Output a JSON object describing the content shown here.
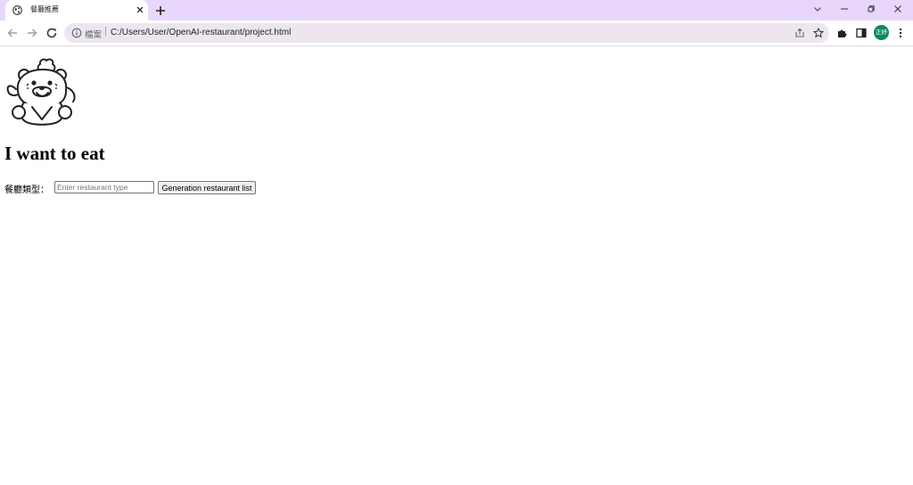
{
  "browser": {
    "tab": {
      "title": "餐廳推薦"
    },
    "address_bar": {
      "scheme_label": "檔案",
      "url": "C:/Users/User/OpenAI-restaurant/project.html"
    },
    "profile": {
      "initials": "正妤",
      "color": "#0b8a5a"
    },
    "theme": {
      "tabstrip_color": "#e9d7fb",
      "omnibox_color": "#ede6f1"
    }
  },
  "page": {
    "heading": "I want to eat",
    "form": {
      "label": "餐廳類型：",
      "input": {
        "value": "",
        "placeholder": "Enter restaurant type"
      },
      "button_label": "Generation restaurant list"
    },
    "logo": {
      "icon": "chef-bear-icon"
    }
  }
}
